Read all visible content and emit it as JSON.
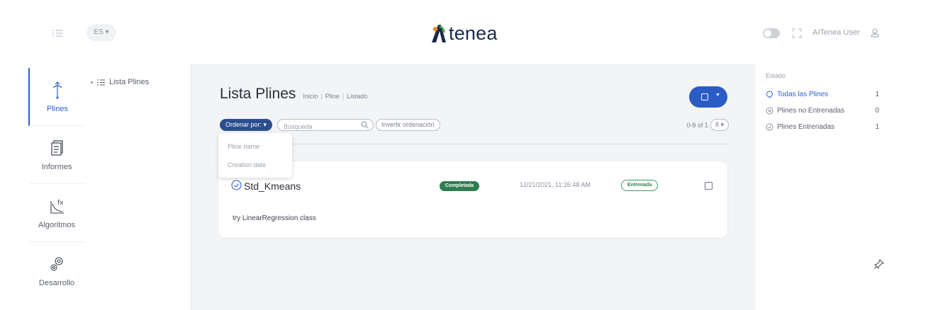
{
  "header": {
    "lang": "ES",
    "brand": "tenea",
    "user_name": "AITenea User"
  },
  "rail": [
    {
      "label": "Plines",
      "icon": "pline-icon"
    },
    {
      "label": "Informes",
      "icon": "report-icon"
    },
    {
      "label": "Algoritmos",
      "icon": "function-icon"
    },
    {
      "label": "Desarrollo",
      "icon": "gears-icon"
    }
  ],
  "subnav": {
    "item": "Lista Plines"
  },
  "page": {
    "title": "Lista Plines",
    "breadcrumb": [
      "Inicio",
      "Pline",
      "Listado"
    ]
  },
  "toolbar": {
    "sort_label": "Ordenar por:",
    "search_placeholder": "Búsqueda",
    "invert_label": "Invertir ordenación",
    "page_info": "0-8 of 1",
    "page_size": "8"
  },
  "sort_menu": [
    "Pline name",
    "Creation date"
  ],
  "card": {
    "title": "Std_Kmeans",
    "status": "Completada",
    "date": "12/21/2021, 11:26:48 AM",
    "training": "Entrenada",
    "description": "try LinearRegression class"
  },
  "filters": {
    "heading": "Estado",
    "items": [
      {
        "label": "Todas las Plines",
        "count": "1"
      },
      {
        "label": "Plines no Entrenadas",
        "count": "0"
      },
      {
        "label": "Plines Entrenadas",
        "count": "1"
      }
    ]
  },
  "colors": {
    "accent": "#2d5fd6",
    "sort_button": "#2b4e8f",
    "action_button": "#2b5bc4",
    "completed": "#2e7d4f",
    "logo_orange": "#f08a24",
    "logo_green": "#4caf50"
  }
}
